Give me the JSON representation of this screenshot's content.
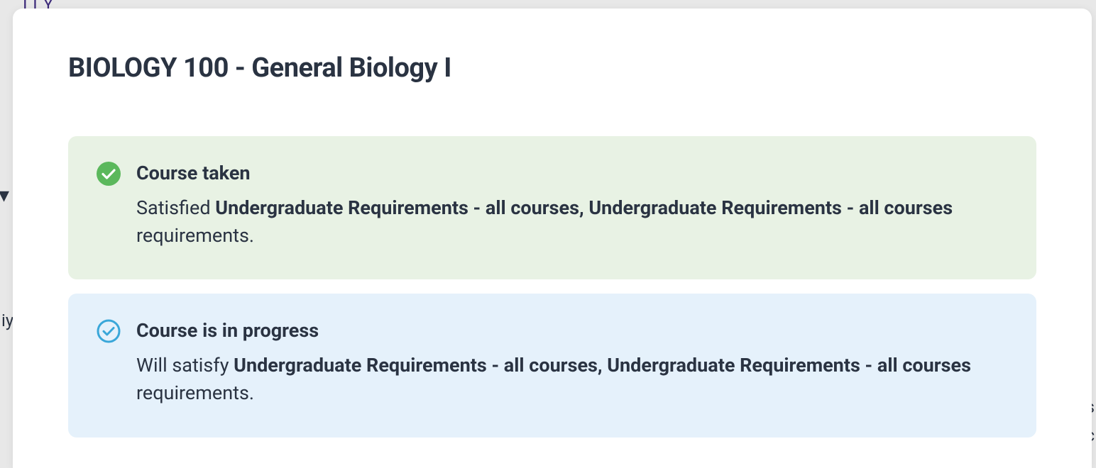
{
  "modal": {
    "title": "BIOLOGY 100 - General Biology I"
  },
  "statuses": [
    {
      "kind": "taken",
      "icon": "check-circle-filled",
      "heading": "Course taken",
      "desc_prefix": "Satisfied ",
      "desc_bold": "Undergraduate Requirements - all courses, Undergraduate Requirements - all courses",
      "desc_suffix": " requirements."
    },
    {
      "kind": "inprogress",
      "icon": "check-circle-outline",
      "heading": "Course is in progress",
      "desc_prefix": "Will satisfy ",
      "desc_bold": "Undergraduate Requirements - all courses, Undergraduate Requirements - all courses",
      "desc_suffix": " requirements."
    }
  ],
  "bg": {
    "frag1": "ITY",
    "frag2": "iy",
    "frag3": "s",
    "frag4": "c"
  },
  "colors": {
    "green_bg": "#e8f2e4",
    "blue_bg": "#e5f1fb",
    "green_icon": "#5bb85c",
    "blue_icon": "#3aa7d9",
    "text": "#2a3342"
  }
}
